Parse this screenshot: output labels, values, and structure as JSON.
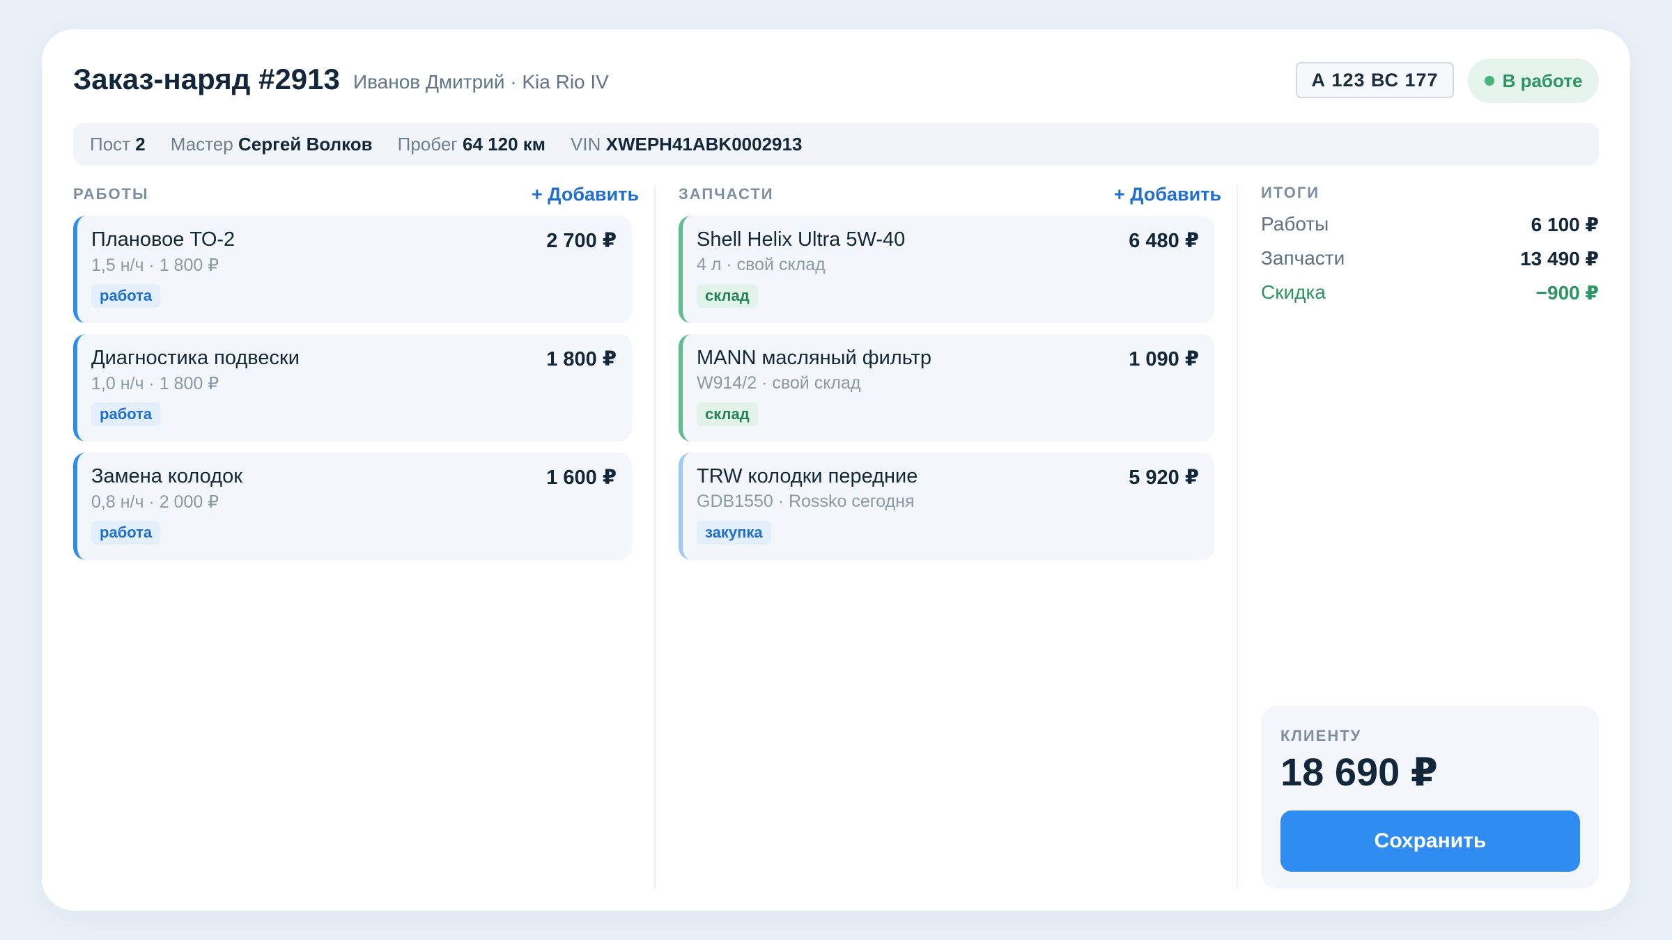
{
  "header": {
    "title": "Заказ-наряд #2913",
    "subtitle": "Иванов Дмитрий · Kia Rio IV",
    "plate": "А 123 ВС 177",
    "status": "В работе",
    "status_color": "#46b47c"
  },
  "info": {
    "post_label": "Пост",
    "post_value": "2",
    "master_label": "Мастер",
    "master_value": "Сергей Волков",
    "mileage_label": "Пробег",
    "mileage_value": "64 120 км",
    "vin_label": "VIN",
    "vin_value": "XWEPH41ABK0002913"
  },
  "works": {
    "heading": "РАБОТЫ",
    "add_label": "+ Добавить",
    "items": [
      {
        "name": "Плановое ТО-2",
        "price": "2 700 ₽",
        "detail": "1,5 н/ч · 1 800 ₽",
        "tag": "работа"
      },
      {
        "name": "Диагностика подвески",
        "price": "1 800 ₽",
        "detail": "1,0 н/ч · 1 800 ₽",
        "tag": "работа"
      },
      {
        "name": "Замена колодок",
        "price": "1 600 ₽",
        "detail": "0,8 н/ч · 2 000 ₽",
        "tag": "работа"
      }
    ]
  },
  "parts": {
    "heading": "ЗАПЧАСТИ",
    "add_label": "+ Добавить",
    "items": [
      {
        "name": "Shell Helix Ultra 5W-40",
        "price": "6 480 ₽",
        "detail": "4 л · свой склад",
        "tag": "склад"
      },
      {
        "name": "MANN масляный фильтр",
        "price": "1 090 ₽",
        "detail": "W914/2 · свой склад",
        "tag": "склад"
      },
      {
        "name": "TRW колодки передние",
        "price": "5 920 ₽",
        "detail": "GDB1550 · Rossko сегодня",
        "tag": "закупка"
      }
    ]
  },
  "totals": {
    "heading": "ИТОГИ",
    "works_label": "Работы",
    "works_value": "6 100 ₽",
    "parts_label": "Запчасти",
    "parts_value": "13 490 ₽",
    "discount_label": "Скидка",
    "discount_value": "−900 ₽",
    "client_label": "КЛИЕНТУ",
    "client_total": "18 690 ₽",
    "save_label": "Сохранить"
  },
  "colors": {
    "accent": "#2f8cf0",
    "success": "#2d9561",
    "part_border_stock": "#5fbd8c",
    "part_border_purchase": "#9ecaf5"
  }
}
